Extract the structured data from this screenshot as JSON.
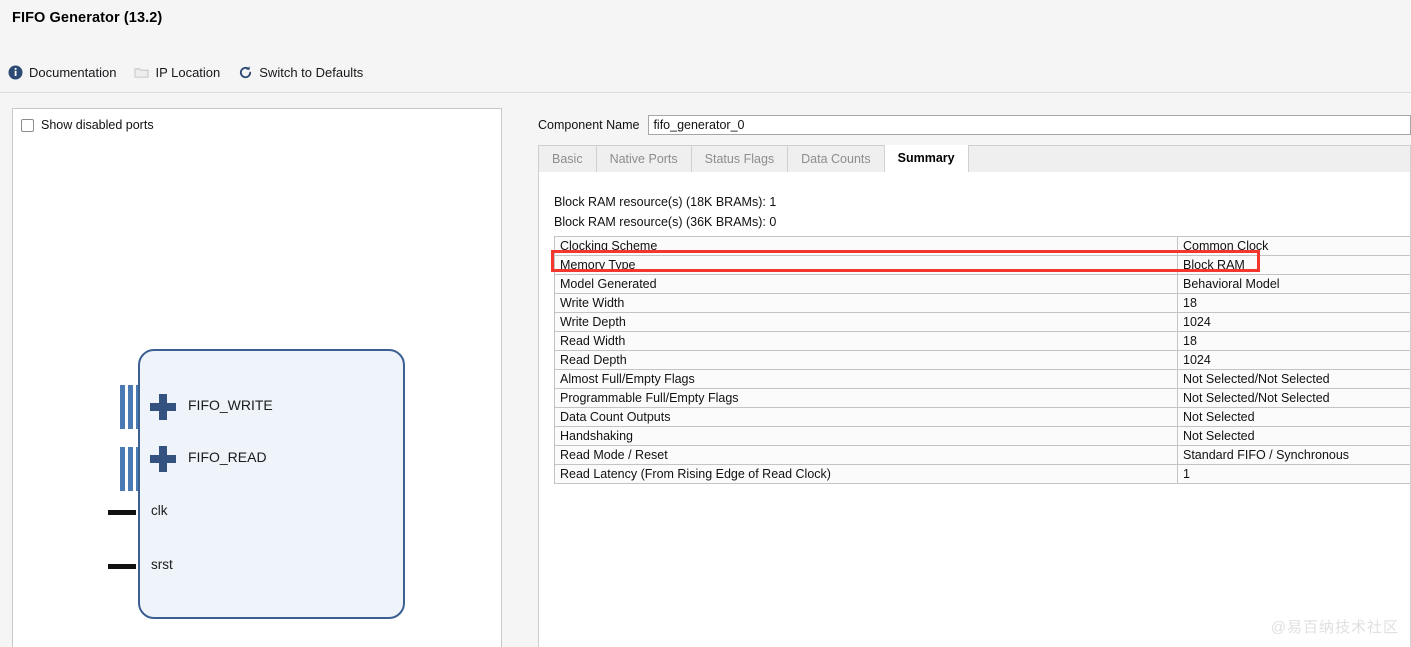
{
  "window": {
    "title": "FIFO Generator (13.2)"
  },
  "toolbar": {
    "items": [
      {
        "label": "Documentation",
        "icon": "info-icon"
      },
      {
        "label": "IP Location",
        "icon": "folder-icon"
      },
      {
        "label": "Switch to Defaults",
        "icon": "refresh-icon"
      }
    ]
  },
  "left_panel": {
    "show_disabled_ports": {
      "label": "Show disabled ports",
      "checked": false
    },
    "symbol": {
      "buses": [
        {
          "label": "FIFO_WRITE",
          "expand": "+"
        },
        {
          "label": "FIFO_READ",
          "expand": "+"
        }
      ],
      "pins": [
        {
          "label": "clk"
        },
        {
          "label": "srst"
        }
      ]
    }
  },
  "right_panel": {
    "component_name": {
      "label": "Component Name",
      "value": "fifo_generator_0",
      "placeholder": "fifo_generator_0"
    },
    "tabs": [
      {
        "label": "Basic",
        "active": false
      },
      {
        "label": "Native Ports",
        "active": false
      },
      {
        "label": "Status Flags",
        "active": false
      },
      {
        "label": "Data Counts",
        "active": false
      },
      {
        "label": "Summary",
        "active": true
      }
    ],
    "summary": {
      "bram_18k": "Block RAM resource(s) (18K BRAMs): 1",
      "bram_36k": "Block RAM resource(s) (36K BRAMs): 0",
      "rows": [
        {
          "key": "Clocking Scheme",
          "value": "Common Clock",
          "highlighted": false
        },
        {
          "key": "Memory Type",
          "value": "Block RAM",
          "highlighted": true
        },
        {
          "key": "Model Generated",
          "value": "Behavioral Model",
          "highlighted": false
        },
        {
          "key": "Write Width",
          "value": "18",
          "highlighted": false
        },
        {
          "key": "Write Depth",
          "value": "1024",
          "highlighted": false
        },
        {
          "key": "Read Width",
          "value": "18",
          "highlighted": false
        },
        {
          "key": "Read Depth",
          "value": "1024",
          "highlighted": false
        },
        {
          "key": "Almost Full/Empty Flags",
          "value": "Not Selected/Not Selected",
          "highlighted": false
        },
        {
          "key": "Programmable Full/Empty Flags",
          "value": "Not Selected/Not Selected",
          "highlighted": false
        },
        {
          "key": "Data Count Outputs",
          "value": "Not Selected",
          "highlighted": false
        },
        {
          "key": "Handshaking",
          "value": "Not Selected",
          "highlighted": false
        },
        {
          "key": "Read Mode / Reset",
          "value": "Standard FIFO / Synchronous",
          "highlighted": false
        },
        {
          "key": "Read Latency (From Rising Edge of Read Clock)",
          "value": "1",
          "highlighted": false
        }
      ]
    }
  },
  "annotation": {
    "highlight_color": "#f4362c",
    "target_row": "Memory Type"
  },
  "watermark": {
    "text": "@易百纳技术社区"
  }
}
